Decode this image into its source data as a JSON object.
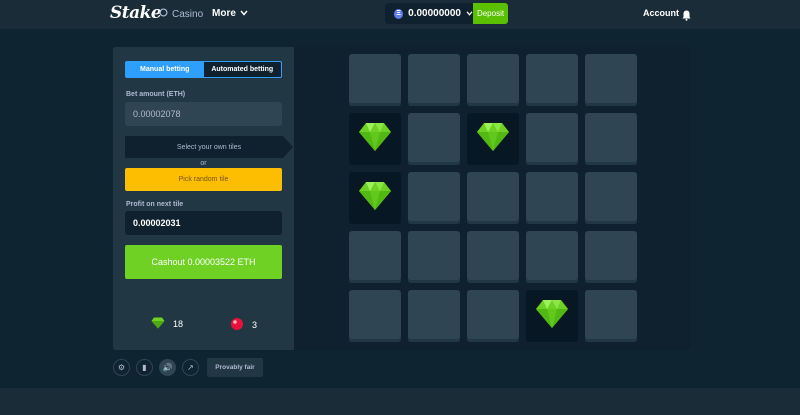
{
  "header": {
    "logo": "Stake",
    "nav_casino": "Casino",
    "nav_more": "More",
    "balance": "0.00000000",
    "currency_icon": "eth-icon",
    "deposit": "Deposit",
    "account": "Account"
  },
  "sidebar": {
    "tab_manual": "Manual betting",
    "tab_auto": "Automated betting",
    "bet_label": "Bet amount (ETH)",
    "bet_value": "0.00002078",
    "select_tiles": "Select your own tiles",
    "or": "or",
    "random_button": "Pick random tile",
    "profit_label": "Profit on next tile",
    "profit_value": "0.00002031",
    "cashout": "Cashout 0.00003522 ETH",
    "gems_count": "18",
    "mines_count": "3"
  },
  "board": {
    "rows": 5,
    "cols": 5,
    "revealed_gems": [
      [
        1,
        0
      ],
      [
        1,
        2
      ],
      [
        2,
        0
      ],
      [
        4,
        3
      ]
    ]
  },
  "footer": {
    "provably_fair": "Provably fair"
  },
  "colors": {
    "bg": "#0e2431",
    "panel": "#213743",
    "tile": "#2f4553",
    "accent_blue": "#2f9fff",
    "green": "#6fd124",
    "yellow": "#fdbd00"
  }
}
